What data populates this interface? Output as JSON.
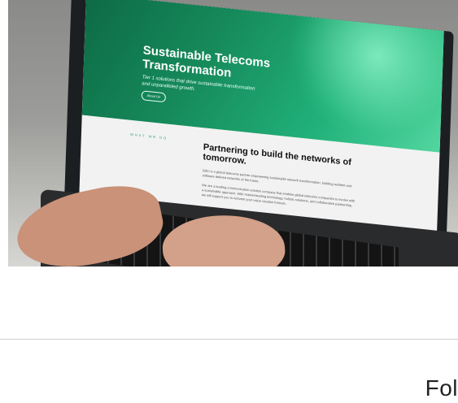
{
  "photo": {
    "hero": {
      "title": "Sustainable Telecoms Transformation",
      "subtitle": "Tier 1 solutions that drive sustainable transformation and unparalleled growth.",
      "button_label": "About Us"
    },
    "section": {
      "label": "WHAT WE DO",
      "title": "Partnering to build the networks of tomorrow.",
      "paragraphs": [
        "Gtlrn is a global telecoms partner empowering sustainable network transformation, building resilient and software defined networks of the future.",
        "We are a leading communication solution company that enables global telecoms companies to evolve with a sustainable approach. With market-leading technology, holistic solutions, and collaborative partnership, we will support you to reinvent your value creation formula."
      ]
    }
  },
  "footer": {
    "fragment": "Fol"
  },
  "colors": {
    "hero_green": "#168a5a",
    "accent_green": "#18a56a"
  }
}
